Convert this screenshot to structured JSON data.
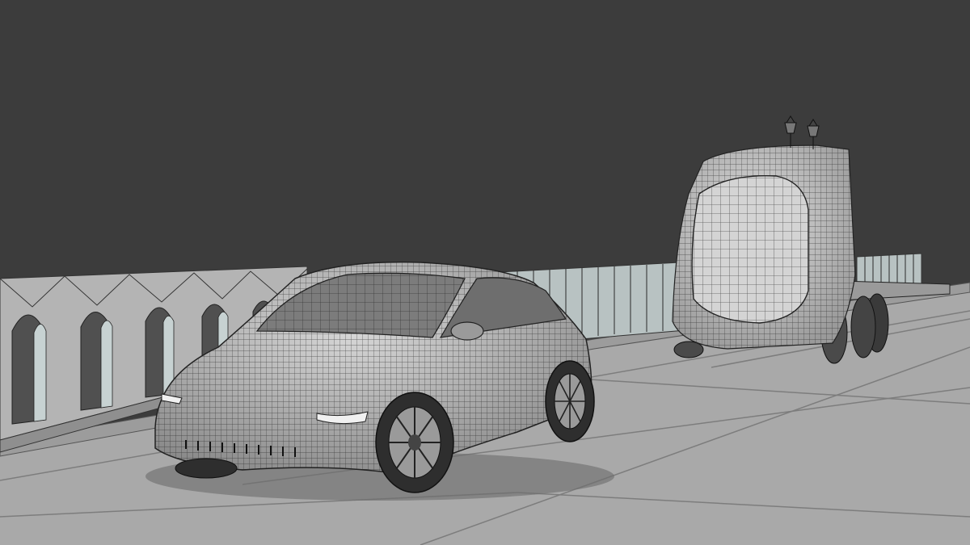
{
  "scene": {
    "background_color": "#3c3c3c",
    "ground_color": "#a9a9a9",
    "wall_color": "#b4b4b4",
    "mesh_line_color": "#1e1e1e",
    "shading": "wireframe-on-shaded",
    "objects": [
      {
        "name": "crossover-car",
        "icon": "car-icon"
      },
      {
        "name": "autonomous-truck",
        "icon": "truck-icon"
      },
      {
        "name": "arched-wall",
        "icon": "wall-icon"
      },
      {
        "name": "bridge-railing",
        "icon": "railing-icon"
      },
      {
        "name": "ground-plane",
        "icon": "plane-icon"
      }
    ]
  }
}
